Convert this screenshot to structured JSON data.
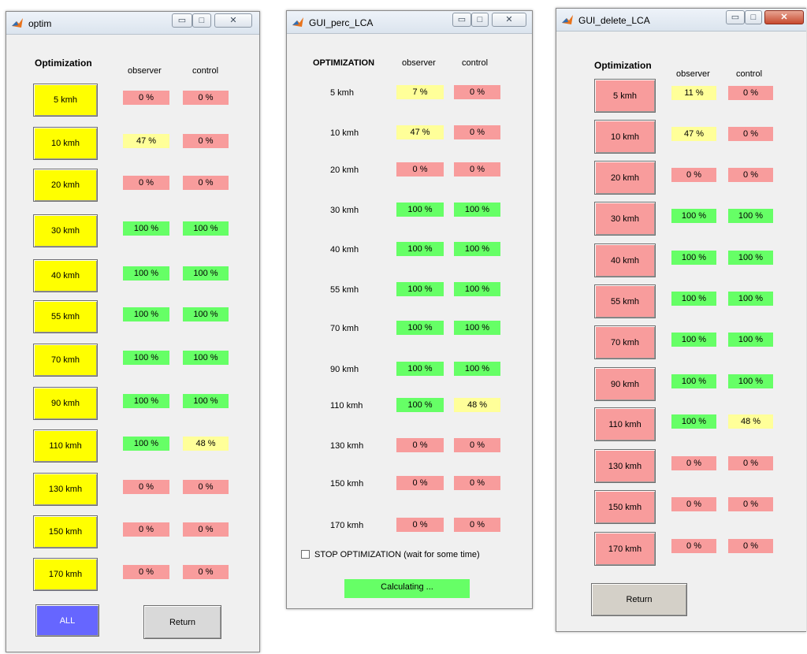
{
  "colors": {
    "green": "#66ff66",
    "red": "#f89c9c",
    "yellow": "#ffff99",
    "button_yellow": "#ffff00",
    "button_blue": "#6666ff"
  },
  "icons": {
    "app": "matlab-icon",
    "minimize": "minimize-icon",
    "maximize": "maximize-icon",
    "close": "close-icon"
  },
  "win1": {
    "title": "optim",
    "header": "Optimization",
    "col_observer": "observer",
    "col_control": "control",
    "rows": [
      {
        "label": "5 kmh",
        "observer": "0 %",
        "control": "0 %"
      },
      {
        "label": "10 kmh",
        "observer": "47 %",
        "control": "0 %"
      },
      {
        "label": "20 kmh",
        "observer": "0 %",
        "control": "0 %"
      },
      {
        "label": "30 kmh",
        "observer": "100 %",
        "control": "100 %"
      },
      {
        "label": "40 kmh",
        "observer": "100 %",
        "control": "100 %"
      },
      {
        "label": "55 kmh",
        "observer": "100 %",
        "control": "100 %"
      },
      {
        "label": "70 kmh",
        "observer": "100 %",
        "control": "100 %"
      },
      {
        "label": "90 kmh",
        "observer": "100 %",
        "control": "100 %"
      },
      {
        "label": "110 kmh",
        "observer": "100 %",
        "control": "48 %"
      },
      {
        "label": "130 kmh",
        "observer": "0 %",
        "control": "0 %"
      },
      {
        "label": "150 kmh",
        "observer": "0 %",
        "control": "0 %"
      },
      {
        "label": "170 kmh",
        "observer": "0 %",
        "control": "0 %"
      }
    ],
    "all_button": "ALL",
    "return_button": "Return"
  },
  "win2": {
    "title": "GUI_perc_LCA",
    "header": "OPTIMIZATION",
    "col_observer": "observer",
    "col_control": "control",
    "rows": [
      {
        "label": "5 kmh",
        "observer": "7 %",
        "control": "0 %"
      },
      {
        "label": "10 kmh",
        "observer": "47 %",
        "control": "0 %"
      },
      {
        "label": "20 kmh",
        "observer": "0 %",
        "control": "0 %"
      },
      {
        "label": "30 kmh",
        "observer": "100 %",
        "control": "100 %"
      },
      {
        "label": "40 kmh",
        "observer": "100 %",
        "control": "100 %"
      },
      {
        "label": "55 kmh",
        "observer": "100 %",
        "control": "100 %"
      },
      {
        "label": "70 kmh",
        "observer": "100 %",
        "control": "100 %"
      },
      {
        "label": "90 kmh",
        "observer": "100 %",
        "control": "100 %"
      },
      {
        "label": "110 kmh",
        "observer": "100 %",
        "control": "48 %"
      },
      {
        "label": "130 kmh",
        "observer": "0 %",
        "control": "0 %"
      },
      {
        "label": "150 kmh",
        "observer": "0 %",
        "control": "0 %"
      },
      {
        "label": "170 kmh",
        "observer": "0 %",
        "control": "0 %"
      }
    ],
    "stop_checkbox": "STOP OPTIMIZATION (wait for some time)",
    "status": "Calculating ..."
  },
  "win3": {
    "title": "GUI_delete_LCA",
    "header": "Optimization",
    "col_observer": "observer",
    "col_control": "control",
    "rows": [
      {
        "label": "5 kmh",
        "observer": "11 %",
        "control": "0 %"
      },
      {
        "label": "10 kmh",
        "observer": "47 %",
        "control": "0 %"
      },
      {
        "label": "20 kmh",
        "observer": "0 %",
        "control": "0 %"
      },
      {
        "label": "30 kmh",
        "observer": "100 %",
        "control": "100 %"
      },
      {
        "label": "40 kmh",
        "observer": "100 %",
        "control": "100 %"
      },
      {
        "label": "55 kmh",
        "observer": "100 %",
        "control": "100 %"
      },
      {
        "label": "70 kmh",
        "observer": "100 %",
        "control": "100 %"
      },
      {
        "label": "90 kmh",
        "observer": "100 %",
        "control": "100 %"
      },
      {
        "label": "110 kmh",
        "observer": "100 %",
        "control": "48 %"
      },
      {
        "label": "130 kmh",
        "observer": "0 %",
        "control": "0 %"
      },
      {
        "label": "150 kmh",
        "observer": "0 %",
        "control": "0 %"
      },
      {
        "label": "170 kmh",
        "observer": "0 %",
        "control": "0 %"
      }
    ],
    "return_button": "Return"
  }
}
